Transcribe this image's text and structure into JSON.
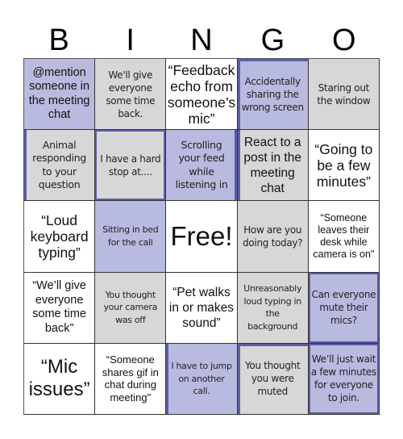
{
  "title_letters": [
    "B",
    "I",
    "N",
    "G",
    "O"
  ],
  "colors": {
    "purple": "#b9badf",
    "gray": "#d7d7d7",
    "white": "#ffffff",
    "accent_border": "#5b5ea8"
  },
  "cells": [
    [
      {
        "text": "@mention someone in the meeting chat",
        "bg": "purple"
      },
      {
        "text": "We'll give everyone some time back.",
        "bg": "gray"
      },
      {
        "text": "“Feedback echo from someone’s mic”",
        "bg": "white"
      },
      {
        "text": "Accidentally sharing the wrong screen",
        "bg": "purple"
      },
      {
        "text": "Staring out the window",
        "bg": "gray"
      }
    ],
    [
      {
        "text": "Animal responding to your question",
        "bg": "gray"
      },
      {
        "text": "I have a hard stop at....",
        "bg": "gray"
      },
      {
        "text": "Scrolling your feed while listening in",
        "bg": "purple"
      },
      {
        "text": "React to a post in the meeting chat",
        "bg": "gray"
      },
      {
        "text": "“Going to be a few minutes”",
        "bg": "white"
      }
    ],
    [
      {
        "text": "“Loud keyboard typing”",
        "bg": "white"
      },
      {
        "text": "Sitting in bed for the call",
        "bg": "purple"
      },
      {
        "text": "Free!",
        "bg": "white"
      },
      {
        "text": "How are you doing today?",
        "bg": "gray"
      },
      {
        "text": "“Someone leaves their desk while camera is on\"",
        "bg": "white"
      }
    ],
    [
      {
        "text": "“We’ll give everyone some time back”",
        "bg": "white"
      },
      {
        "text": "You thought your camera was off",
        "bg": "gray"
      },
      {
        "text": "“Pet walks in or makes sound”",
        "bg": "white"
      },
      {
        "text": "Unreasonably loud typing in the background",
        "bg": "gray"
      },
      {
        "text": "Can everyone mute their mics?",
        "bg": "purple"
      }
    ],
    [
      {
        "text": "“Mic issues”",
        "bg": "white"
      },
      {
        "text": "“Someone shares gif in chat during meeting\"",
        "bg": "white"
      },
      {
        "text": "I have to jump on another call.",
        "bg": "purple"
      },
      {
        "text": "You thought you were muted",
        "bg": "gray"
      },
      {
        "text": "We’ll just wait a few minutes for everyone to join.",
        "bg": "purple"
      }
    ]
  ]
}
